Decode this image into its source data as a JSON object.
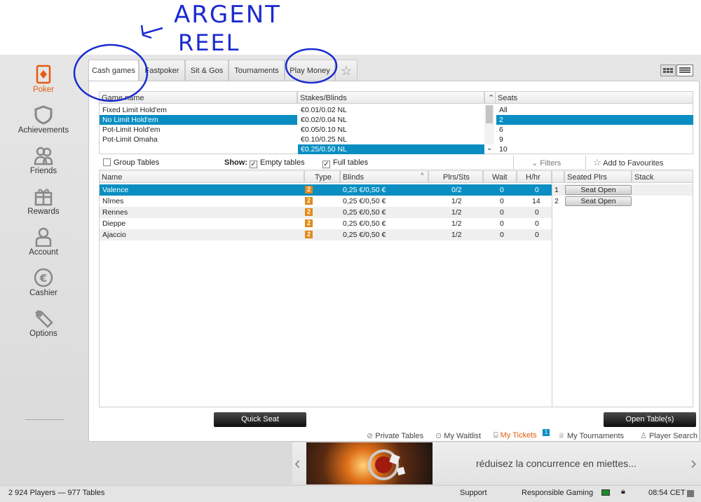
{
  "annotation": {
    "line1": "ARGENT",
    "line2": "REEL"
  },
  "sidebar": {
    "items": [
      {
        "label": "Poker",
        "icon": "poker-icon"
      },
      {
        "label": "Achievements",
        "icon": "shield-icon"
      },
      {
        "label": "Friends",
        "icon": "friends-icon"
      },
      {
        "label": "Rewards",
        "icon": "gift-icon"
      },
      {
        "label": "Account",
        "icon": "user-icon"
      },
      {
        "label": "Cashier",
        "icon": "euro-icon"
      },
      {
        "label": "Options",
        "icon": "wrench-icon"
      }
    ]
  },
  "tabs": [
    "Cash games",
    "Fastpoker",
    "Sit & Gos",
    "Tournaments",
    "Play Money"
  ],
  "filters": {
    "headers": {
      "game": "Game name",
      "stakes": "Stakes/Blinds",
      "seats": "Seats"
    },
    "games": [
      "Fixed Limit Hold'em",
      "No Limit Hold'em",
      "Pot-Limit Hold'em",
      "Pot-Limit Omaha"
    ],
    "stakes": [
      "€0.01/0.02 NL",
      "€0.02/0.04 NL",
      "€0.05/0.10 NL",
      "€0.10/0.25 NL",
      "€0.25/0.50 NL"
    ],
    "seats": [
      "All",
      "2",
      "6",
      "9",
      "10"
    ]
  },
  "options": {
    "group_tables": "Group Tables",
    "show": "Show:",
    "empty_tables": "Empty tables",
    "full_tables": "Full tables",
    "filters": "Filters",
    "add_fav": "Add to Favourites"
  },
  "table": {
    "headers": {
      "name": "Name",
      "type": "Type",
      "blinds": "Blinds",
      "plrs": "Plrs/Sts",
      "wait": "Wait",
      "hhr": "H/hr"
    },
    "rows": [
      {
        "name": "Valence",
        "type": "2",
        "blinds": "0,25 €/0,50 €",
        "plrs": "0/2",
        "wait": "0",
        "hhr": "0"
      },
      {
        "name": "Nîmes",
        "type": "2",
        "blinds": "0,25 €/0,50 €",
        "plrs": "1/2",
        "wait": "0",
        "hhr": "14"
      },
      {
        "name": "Rennes",
        "type": "2",
        "blinds": "0,25 €/0,50 €",
        "plrs": "1/2",
        "wait": "0",
        "hhr": "0"
      },
      {
        "name": "Dieppe",
        "type": "2",
        "blinds": "0,25 €/0,50 €",
        "plrs": "1/2",
        "wait": "0",
        "hhr": "0"
      },
      {
        "name": "Ajaccio",
        "type": "2",
        "blinds": "0,25 €/0,50 €",
        "plrs": "1/2",
        "wait": "0",
        "hhr": "0"
      }
    ]
  },
  "seated": {
    "headers": {
      "seated": "Seated Plrs",
      "stack": "Stack"
    },
    "rows": [
      {
        "num": "1",
        "label": "Seat Open"
      },
      {
        "num": "2",
        "label": "Seat Open"
      }
    ]
  },
  "buttons": {
    "quick_seat": "Quick Seat",
    "open_tables": "Open Table(s)"
  },
  "links": {
    "private": "Private Tables",
    "waitlist": "My Waitlist",
    "tickets": "My Tickets",
    "tickets_count": "1",
    "tournaments": "My Tournaments",
    "player_search": "Player Search"
  },
  "banner": {
    "text": "réduisez la concurrence en miettes..."
  },
  "status": {
    "players": "2 924 Players",
    "sep": "—",
    "tables": "977 Tables",
    "support": "Support",
    "responsible": "Responsible Gaming",
    "time": "08:54 CET"
  },
  "colors": {
    "accent": "#e55c10",
    "selection": "#0a8ec2",
    "badge": "#e08a1a",
    "annotation": "#1a2bd0"
  }
}
